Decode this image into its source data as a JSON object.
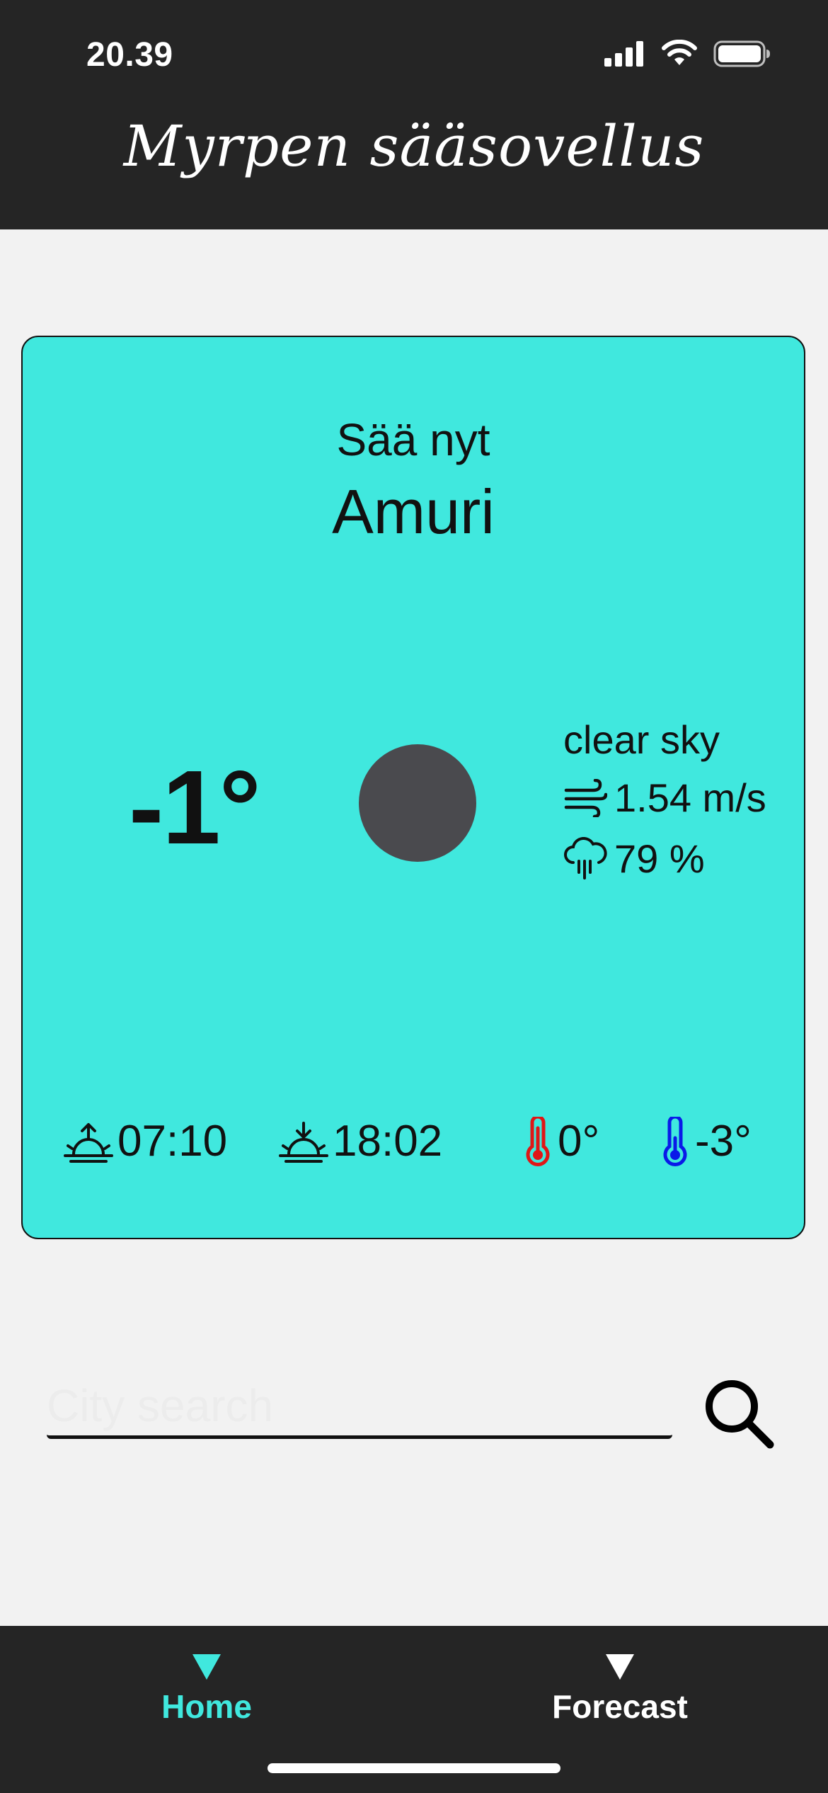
{
  "status_bar": {
    "time": "20.39"
  },
  "header": {
    "title": "Myrpen sääsovellus"
  },
  "card": {
    "subtitle": "Sää nyt",
    "city": "Amuri",
    "temperature": "-1°",
    "description": "clear sky",
    "wind": "1.54 m/s",
    "humidity": "79 %",
    "sunrise": "07:10",
    "sunset": "18:02",
    "temp_max": "0°",
    "temp_min": "-3°",
    "colors": {
      "card_bg": "#40e8de",
      "max_icon": "#e01616",
      "min_icon": "#0a1ae8"
    }
  },
  "search": {
    "placeholder": "City search",
    "value": ""
  },
  "nav": {
    "tabs": [
      {
        "label": "Home",
        "active": true
      },
      {
        "label": "Forecast",
        "active": false
      }
    ],
    "active_color": "#40e8de"
  }
}
